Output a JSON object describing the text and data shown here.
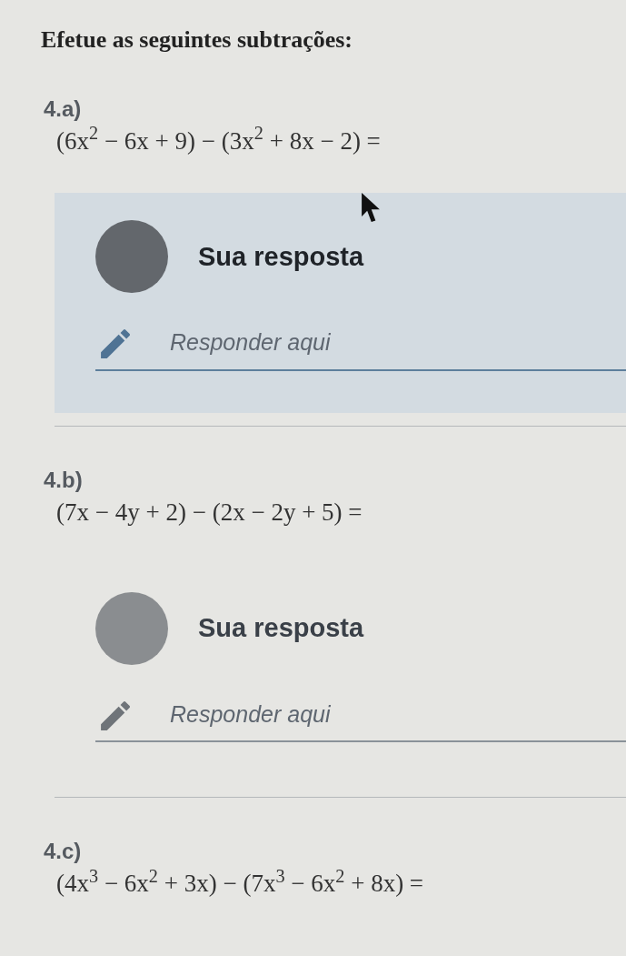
{
  "title": "Efetue as seguintes subtrações:",
  "questions": [
    {
      "label": "4.a)",
      "expression": "(6x$^{2}$ − 6x + 9) − (3x$^{2}$ + 8x − 2) =",
      "answer": {
        "heading": "Sua resposta",
        "placeholder": "Responder aqui",
        "focused": true
      }
    },
    {
      "label": "4.b)",
      "expression": "(7x − 4y + 2) − (2x − 2y + 5) =",
      "answer": {
        "heading": "Sua resposta",
        "placeholder": "Responder aqui",
        "focused": false
      }
    },
    {
      "label": "4.c)",
      "expression": "(4x$^{3}$ − 6x$^{2}$ + 3x) − (7x$^{3}$ − 6x$^{2}$ + 8x) ="
    }
  ]
}
